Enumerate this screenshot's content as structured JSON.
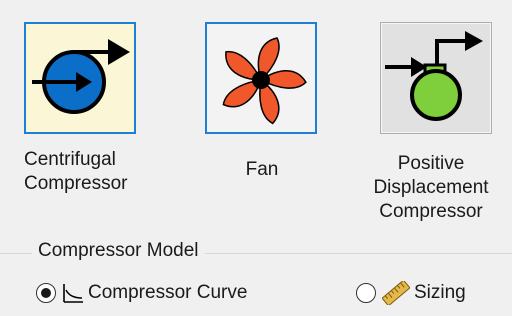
{
  "compressor_types": {
    "centrifugal": {
      "label": "Centrifugal\nCompressor",
      "icon": "centrifugal-compressor-icon",
      "selected": true
    },
    "fan": {
      "label": "Fan",
      "icon": "fan-icon",
      "selected": false
    },
    "positive_displacement": {
      "label": "Positive\nDisplacement\nCompressor",
      "icon": "positive-displacement-compressor-icon",
      "selected": false
    }
  },
  "compressor_model": {
    "title": "Compressor Model",
    "options": [
      {
        "label": "Compressor Curve",
        "icon": "curve-chart-icon",
        "checked": true
      },
      {
        "label": "Sizing",
        "icon": "ruler-icon",
        "checked": false
      }
    ]
  },
  "colors": {
    "selection_border": "#1e7fd3",
    "selected_bg": "#fbf7d6",
    "centrifugal_fill": "#0b6fc9",
    "fan_fill": "#f0572a",
    "pd_fill": "#7fcf3d",
    "ruler_fill": "#e6b84a"
  }
}
